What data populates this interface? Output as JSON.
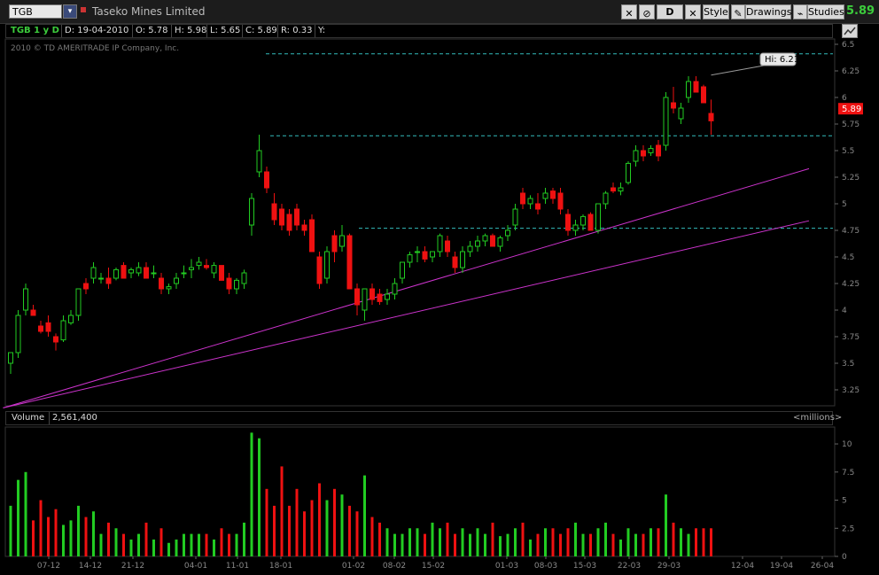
{
  "toolbar": {
    "symbol": "TGB",
    "company": "Taseko Mines Limited",
    "aggregation": "D",
    "style_label": "Style",
    "drawings_label": "Drawings",
    "studies_label": "Studies",
    "last_price": "5.89"
  },
  "info": {
    "symbol_period": "TGB 1 y D",
    "date": "D: 19-04-2010",
    "open": "O: 5.78",
    "high": "H: 5.98",
    "low": "L: 5.65",
    "close": "C: 5.89",
    "range": "R: 0.33",
    "y": "Y:"
  },
  "copyright": "2010 © TD AMERITRADE IP Company, Inc.",
  "hi_label": "Hi: 6.21",
  "price_tag": "5.89",
  "volume": {
    "label": "Volume",
    "value": "2,561,400",
    "units": "<millions>"
  },
  "colors": {
    "up": "#22cc22",
    "down": "#ee1111",
    "trend": "#cc33cc",
    "level": "#33bbbb"
  },
  "chart_data": {
    "type": "candlestick",
    "price_ticks": [
      "6.5",
      "6.25",
      "6",
      "5.75",
      "5.5",
      "5.25",
      "5",
      "4.75",
      "4.5",
      "4.25",
      "4",
      "3.75",
      "3.5",
      "3.25"
    ],
    "volume_ticks": [
      "10",
      "7.5",
      "5",
      "2.5",
      "0"
    ],
    "x_ticks": [
      "07-12",
      "14-12",
      "21-12",
      "04-01",
      "11-01",
      "18-01",
      "01-02",
      "08-02",
      "15-02",
      "01-03",
      "08-03",
      "15-03",
      "22-03",
      "29-03",
      "12-04",
      "19-04",
      "26-04"
    ],
    "ylim": [
      3.1,
      6.55
    ],
    "vol_ylim": [
      0,
      11.5
    ],
    "levels": [
      6.41,
      5.64,
      4.77
    ],
    "trend_lines": [
      {
        "from": {
          "i": -1,
          "v": 3.08
        },
        "to": {
          "i": 106,
          "v": 5.33
        }
      },
      {
        "from": {
          "i": -1,
          "v": 3.08
        },
        "to": {
          "i": 106,
          "v": 4.84
        }
      }
    ],
    "candles": [
      [
        3.5,
        3.6,
        3.4,
        3.6,
        4.5
      ],
      [
        3.6,
        4.0,
        3.55,
        3.95,
        6.8
      ],
      [
        4.0,
        4.25,
        3.95,
        4.2,
        7.5
      ],
      [
        4.0,
        4.05,
        3.95,
        3.95,
        3.2
      ],
      [
        3.85,
        3.9,
        3.78,
        3.8,
        5.0
      ],
      [
        3.88,
        3.95,
        3.75,
        3.8,
        3.5
      ],
      [
        3.75,
        3.78,
        3.62,
        3.7,
        4.2
      ],
      [
        3.72,
        3.95,
        3.7,
        3.9,
        2.8
      ],
      [
        3.88,
        4.0,
        3.86,
        3.95,
        3.2
      ],
      [
        3.95,
        4.2,
        3.9,
        4.2,
        4.5
      ],
      [
        4.25,
        4.3,
        4.15,
        4.2,
        3.5
      ],
      [
        4.3,
        4.45,
        4.25,
        4.4,
        4.0
      ],
      [
        4.3,
        4.35,
        4.25,
        4.3,
        2.0
      ],
      [
        4.3,
        4.4,
        4.2,
        4.25,
        3.0
      ],
      [
        4.3,
        4.4,
        4.28,
        4.38,
        2.5
      ],
      [
        4.42,
        4.45,
        4.3,
        4.3,
        2.0
      ],
      [
        4.35,
        4.4,
        4.3,
        4.38,
        1.5
      ],
      [
        4.35,
        4.45,
        4.32,
        4.4,
        2.0
      ],
      [
        4.4,
        4.45,
        4.3,
        4.3,
        3.0
      ],
      [
        4.35,
        4.42,
        4.3,
        4.35,
        1.5
      ],
      [
        4.3,
        4.35,
        4.15,
        4.2,
        2.5
      ],
      [
        4.2,
        4.25,
        4.15,
        4.22,
        1.2
      ],
      [
        4.25,
        4.35,
        4.2,
        4.3,
        1.5
      ],
      [
        4.35,
        4.42,
        4.3,
        4.35,
        2.0
      ],
      [
        4.38,
        4.48,
        4.3,
        4.4,
        2.0
      ],
      [
        4.42,
        4.5,
        4.38,
        4.45,
        2.0
      ],
      [
        4.42,
        4.48,
        4.38,
        4.4,
        2.0
      ],
      [
        4.35,
        4.45,
        4.3,
        4.42,
        1.5
      ],
      [
        4.42,
        4.42,
        4.28,
        4.28,
        2.5
      ],
      [
        4.3,
        4.35,
        4.15,
        4.2,
        2.0
      ],
      [
        4.2,
        4.3,
        4.15,
        4.28,
        2.0
      ],
      [
        4.25,
        4.38,
        4.2,
        4.35,
        3.0
      ],
      [
        4.8,
        5.1,
        4.7,
        5.05,
        11.0
      ],
      [
        5.3,
        5.65,
        5.25,
        5.5,
        10.5
      ],
      [
        5.3,
        5.35,
        5.1,
        5.15,
        6.0
      ],
      [
        5.0,
        5.1,
        4.8,
        4.85,
        4.5
      ],
      [
        4.95,
        5.0,
        4.75,
        4.8,
        8.0
      ],
      [
        4.9,
        4.95,
        4.7,
        4.75,
        4.5
      ],
      [
        4.95,
        5.0,
        4.75,
        4.8,
        6.0
      ],
      [
        4.8,
        4.85,
        4.7,
        4.75,
        4.0
      ],
      [
        4.85,
        4.9,
        4.55,
        4.55,
        5.0
      ],
      [
        4.5,
        4.55,
        4.2,
        4.25,
        6.5
      ],
      [
        4.3,
        4.6,
        4.25,
        4.55,
        5.0
      ],
      [
        4.7,
        4.75,
        4.45,
        4.55,
        6.0
      ],
      [
        4.6,
        4.8,
        4.55,
        4.7,
        5.5
      ],
      [
        4.7,
        4.72,
        4.2,
        4.2,
        4.5
      ],
      [
        4.2,
        4.25,
        3.95,
        4.05,
        4.0
      ],
      [
        4.0,
        4.2,
        3.9,
        4.2,
        7.2
      ],
      [
        4.2,
        4.25,
        4.05,
        4.1,
        3.5
      ],
      [
        4.15,
        4.2,
        4.05,
        4.08,
        3.0
      ],
      [
        4.1,
        4.2,
        4.05,
        4.15,
        2.5
      ],
      [
        4.15,
        4.3,
        4.1,
        4.25,
        2.0
      ],
      [
        4.3,
        4.45,
        4.25,
        4.45,
        2.0
      ],
      [
        4.45,
        4.55,
        4.4,
        4.52,
        2.5
      ],
      [
        4.55,
        4.6,
        4.45,
        4.55,
        2.5
      ],
      [
        4.55,
        4.6,
        4.45,
        4.48,
        2.0
      ],
      [
        4.5,
        4.55,
        4.45,
        4.55,
        3.0
      ],
      [
        4.55,
        4.72,
        4.5,
        4.7,
        2.5
      ],
      [
        4.65,
        4.7,
        4.5,
        4.55,
        3.0
      ],
      [
        4.5,
        4.55,
        4.35,
        4.4,
        2.0
      ],
      [
        4.4,
        4.6,
        4.35,
        4.55,
        2.5
      ],
      [
        4.55,
        4.65,
        4.5,
        4.6,
        2.0
      ],
      [
        4.6,
        4.7,
        4.55,
        4.65,
        2.5
      ],
      [
        4.65,
        4.72,
        4.6,
        4.7,
        2.0
      ],
      [
        4.7,
        4.72,
        4.6,
        4.6,
        3.0
      ],
      [
        4.6,
        4.7,
        4.55,
        4.68,
        1.8
      ],
      [
        4.7,
        4.8,
        4.65,
        4.75,
        2.0
      ],
      [
        4.8,
        5.0,
        4.75,
        4.95,
        2.5
      ],
      [
        5.1,
        5.15,
        4.95,
        5.0,
        3.0
      ],
      [
        5.0,
        5.08,
        4.95,
        5.05,
        1.5
      ],
      [
        5.0,
        5.1,
        4.9,
        4.95,
        2.0
      ],
      [
        5.05,
        5.15,
        5.0,
        5.1,
        2.5
      ],
      [
        5.12,
        5.15,
        5.0,
        5.05,
        2.5
      ],
      [
        5.1,
        5.15,
        4.9,
        4.95,
        2.0
      ],
      [
        4.9,
        4.95,
        4.7,
        4.75,
        2.5
      ],
      [
        4.75,
        4.85,
        4.7,
        4.8,
        3.0
      ],
      [
        4.8,
        4.9,
        4.75,
        4.88,
        2.0
      ],
      [
        4.9,
        4.92,
        4.75,
        4.75,
        2.0
      ],
      [
        4.75,
        5.0,
        4.72,
        5.0,
        2.5
      ],
      [
        5.0,
        5.12,
        4.95,
        5.1,
        3.0
      ],
      [
        5.15,
        5.2,
        5.1,
        5.12,
        2.0
      ],
      [
        5.12,
        5.2,
        5.08,
        5.15,
        1.5
      ],
      [
        5.2,
        5.4,
        5.18,
        5.38,
        2.5
      ],
      [
        5.4,
        5.55,
        5.35,
        5.5,
        2.0
      ],
      [
        5.5,
        5.55,
        5.4,
        5.45,
        2.0
      ],
      [
        5.48,
        5.55,
        5.45,
        5.52,
        2.5
      ],
      [
        5.55,
        5.6,
        5.4,
        5.45,
        2.5
      ],
      [
        5.55,
        6.05,
        5.5,
        6.0,
        5.5
      ],
      [
        5.95,
        6.1,
        5.85,
        5.9,
        3.0
      ],
      [
        5.8,
        5.95,
        5.75,
        5.9,
        2.5
      ],
      [
        6.0,
        6.2,
        5.95,
        6.15,
        2.0
      ],
      [
        6.15,
        6.2,
        6.05,
        6.05,
        2.5
      ],
      [
        6.1,
        6.12,
        5.95,
        5.95,
        2.5
      ],
      [
        5.85,
        5.98,
        5.65,
        5.78,
        2.5
      ]
    ]
  }
}
